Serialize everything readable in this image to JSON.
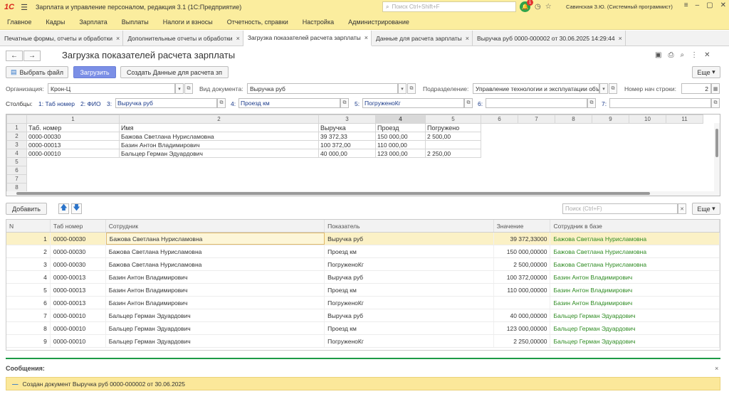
{
  "app": {
    "logo": "1С",
    "title": "Зарплата и управление персоналом, редакция 3.1  (1С:Предприятие)",
    "search_placeholder": "Поиск Ctrl+Shift+F",
    "notifications": "1",
    "user": "Савинская З.Ю. (Системный программист)"
  },
  "menu": [
    "Главное",
    "Кадры",
    "Зарплата",
    "Выплаты",
    "Налоги и взносы",
    "Отчетность, справки",
    "Настройка",
    "Администрирование"
  ],
  "tabs": [
    "Печатные формы, отчеты и обработки",
    "Дополнительные отчеты и обработки",
    "Загрузка показателей расчета зарплаты",
    "Данные для расчета зарплаты",
    "Выручка руб 0000-000002 от 30.06.2025 14:29:44"
  ],
  "form": {
    "title": "Загрузка показателей расчета зарплаты",
    "btn_select": "Выбрать файл",
    "btn_load": "Загрузить",
    "btn_create": "Создать Данные для расчета зп",
    "btn_more": "Еще"
  },
  "fields": {
    "org_label": "Организация:",
    "org_value": "Крон-Ц",
    "doctype_label": "Вид документа:",
    "doctype_value": "Выручка руб",
    "dept_label": "Подразделение:",
    "dept_value": "Управление технологии и эксплуатации объ",
    "startrow_label": "Номер нач строки:",
    "startrow_value": "2"
  },
  "columns": {
    "label": "Столбцы:",
    "c1": "1: Таб номер",
    "c2": "2: ФИО",
    "c3n": "3:",
    "c3v": "Выручка руб",
    "c4n": "4:",
    "c4v": "Проезд км",
    "c5n": "5:",
    "c5v": "ПогруженоКг",
    "c6n": "6:",
    "c6v": "",
    "c7n": "7:",
    "c7v": ""
  },
  "sheet": {
    "col_headers": [
      "1",
      "2",
      "3",
      "4",
      "5",
      "6",
      "7",
      "8",
      "9",
      "10",
      "11"
    ],
    "row_headers": [
      "1",
      "2",
      "3",
      "4",
      "5",
      "6",
      "7",
      "8"
    ],
    "rows": [
      [
        "Таб. номер",
        "Имя",
        "Выручка",
        "Проезд",
        "Погружено"
      ],
      [
        "0000-00030",
        "Бажова Светлана Нурисламовна",
        "39 372,33",
        "150 000,00",
        "2 500,00"
      ],
      [
        "0000-00013",
        "Базин Антон Владимирович",
        "100 372,00",
        "110 000,00",
        ""
      ],
      [
        "0000-00010",
        "Бальцер Герман Эдуардович",
        "40 000,00",
        "123 000,00",
        "2 250,00"
      ]
    ]
  },
  "table": {
    "btn_add": "Добавить",
    "search_placeholder": "Поиск (Ctrl+F)",
    "btn_more": "Еще",
    "headers": [
      "N",
      "Таб номер",
      "Сотрудник",
      "Показатель",
      "Значение",
      "Сотрудник в базе"
    ],
    "rows": [
      [
        "1",
        "0000-00030",
        "Бажова Светлана Нурисламовна",
        "Выручка руб",
        "39 372,33000",
        "Бажова Светлана Нурисламовна"
      ],
      [
        "2",
        "0000-00030",
        "Бажова Светлана Нурисламовна",
        "Проезд км",
        "150 000,00000",
        "Бажова Светлана Нурисламовна"
      ],
      [
        "3",
        "0000-00030",
        "Бажова Светлана Нурисламовна",
        "ПогруженоКг",
        "2 500,00000",
        "Бажова Светлана Нурисламовна"
      ],
      [
        "4",
        "0000-00013",
        "Базин Антон Владимирович",
        "Выручка руб",
        "100 372,00000",
        "Базин Антон Владимирович"
      ],
      [
        "5",
        "0000-00013",
        "Базин Антон Владимирович",
        "Проезд км",
        "110 000,00000",
        "Базин Антон Владимирович"
      ],
      [
        "6",
        "0000-00013",
        "Базин Антон Владимирович",
        "ПогруженоКг",
        "",
        "Базин Антон Владимирович"
      ],
      [
        "7",
        "0000-00010",
        "Бальцер Герман Эдуардович",
        "Выручка руб",
        "40 000,00000",
        "Бальцер Герман Эдуардович"
      ],
      [
        "8",
        "0000-00010",
        "Бальцер Герман Эдуардович",
        "Проезд км",
        "123 000,00000",
        "Бальцер Герман Эдуардович"
      ],
      [
        "9",
        "0000-00010",
        "Бальцер Герман Эдуардович",
        "ПогруженоКг",
        "2 250,00000",
        "Бальцер Герман Эдуардович"
      ]
    ]
  },
  "messages": {
    "title": "Сообщения:",
    "text": "Создан документ Выручка руб 0000-000002 от 30.06.2025"
  }
}
